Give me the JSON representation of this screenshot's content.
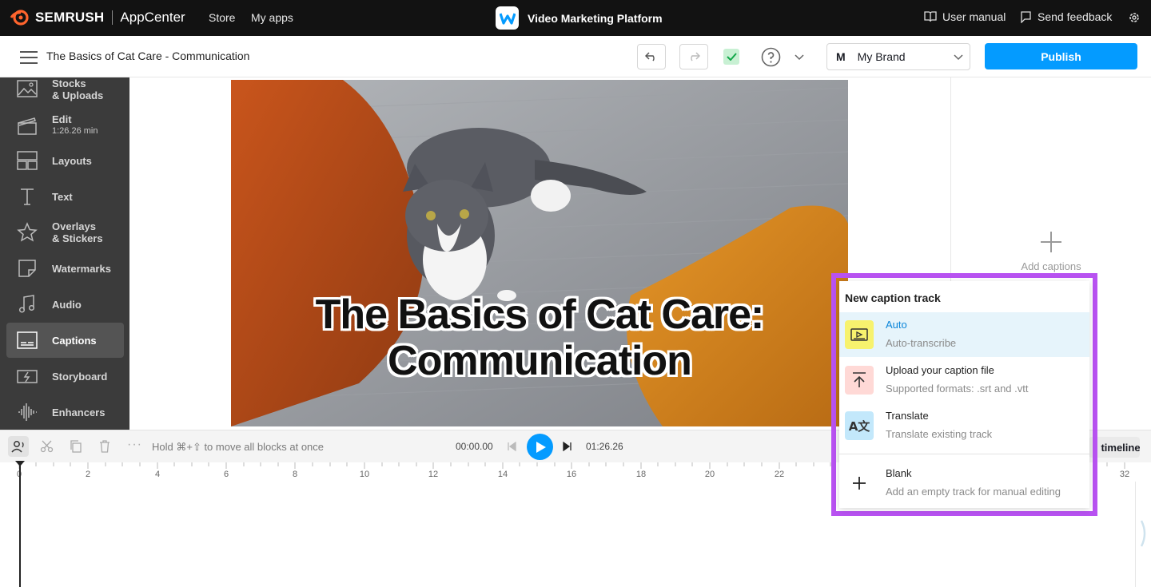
{
  "topbar": {
    "logo_text": "SEMRUSH",
    "app_center": "AppCenter",
    "nav": [
      "Store",
      "My apps"
    ],
    "app_title": "Video Marketing Platform",
    "user_manual": "User manual",
    "send_feedback": "Send feedback"
  },
  "subheader": {
    "doc_title": "The Basics of Cat Care - Communication",
    "brand_initial": "M",
    "brand": "My Brand",
    "publish": "Publish"
  },
  "sidebar": {
    "items": [
      {
        "label": "Stocks",
        "label2": "& Uploads"
      },
      {
        "label": "Edit",
        "sub": "1:26.26 min"
      },
      {
        "label": "Layouts"
      },
      {
        "label": "Text"
      },
      {
        "label": "Overlays",
        "label2": "& Stickers"
      },
      {
        "label": "Watermarks"
      },
      {
        "label": "Audio"
      },
      {
        "label": "Captions"
      },
      {
        "label": "Storyboard"
      },
      {
        "label": "Enhancers"
      }
    ]
  },
  "video": {
    "caption_line1": "The Basics of Cat Care:",
    "caption_line2": "Communication"
  },
  "right_panel": {
    "add_captions": "Add captions"
  },
  "timeline": {
    "hint": "Hold ⌘+⇧ to move all blocks at once",
    "current_time": "00:00.00",
    "total_time": "01:26.26",
    "timeline_button": "timeline",
    "ticks": [
      "0",
      "2",
      "4",
      "6",
      "8",
      "10",
      "12",
      "14",
      "16",
      "18",
      "20",
      "22",
      "32"
    ]
  },
  "popover": {
    "title": "New caption track",
    "options": [
      {
        "label": "Auto",
        "desc": "Auto-transcribe"
      },
      {
        "label": "Upload your caption file",
        "desc": "Supported formats: .srt and .vtt"
      },
      {
        "label": "Translate",
        "desc": "Translate existing track"
      },
      {
        "label": "Blank",
        "desc": "Add an empty track for manual editing"
      }
    ]
  },
  "colors": {
    "accent": "#049bff",
    "highlight": "#b852f1",
    "sidebar": "#3b3b3b",
    "topbar": "#121212"
  }
}
